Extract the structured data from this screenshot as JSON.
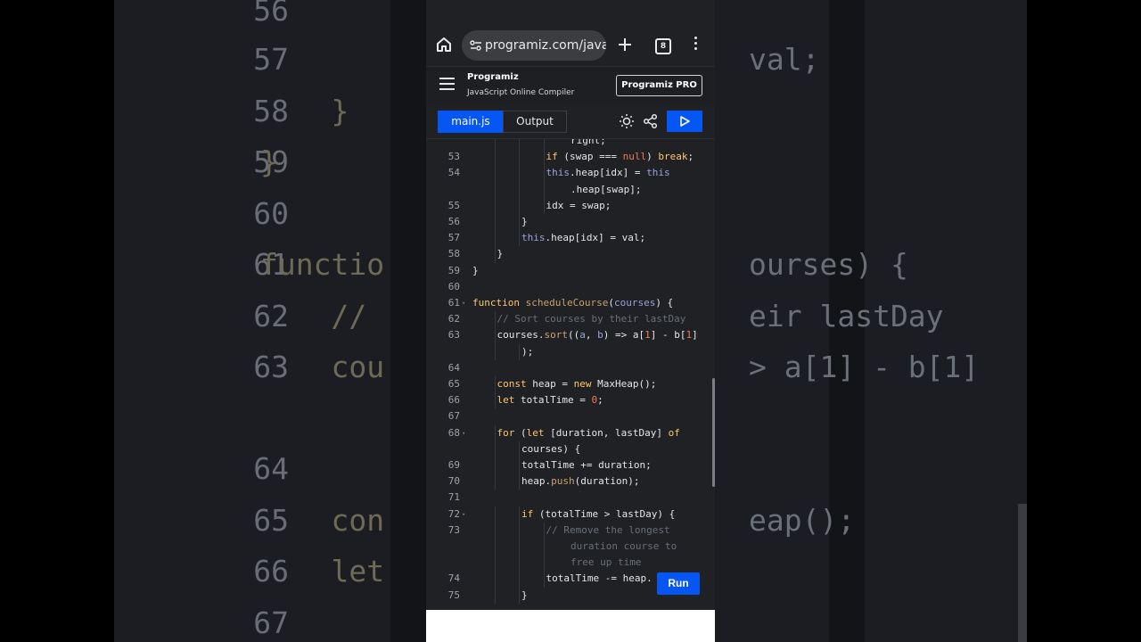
{
  "browser": {
    "url": "programiz.com/javasc",
    "tab_count": "8"
  },
  "site": {
    "logo": "Programiz",
    "subtitle": "JavaScript Online Compiler",
    "pro_button": "Programiz PRO"
  },
  "toolbar": {
    "tab_main": "main.js",
    "tab_output": "Output"
  },
  "run_button": "Run",
  "background": {
    "lines": [
      {
        "num": "56",
        "left": "",
        "right": ""
      },
      {
        "num": "57",
        "left": "",
        "right": "val;"
      },
      {
        "num": "58",
        "left": "    }",
        "right": ""
      },
      {
        "num": "59",
        "left": "}",
        "right": ""
      },
      {
        "num": "60",
        "left": "",
        "right": ""
      },
      {
        "num": "61",
        "left": "functio",
        "right": "ourses) {"
      },
      {
        "num": "62",
        "left": "    //",
        "right": "eir lastDay"
      },
      {
        "num": "63",
        "left": "    cou",
        "right": "> a[1] - b[1]"
      },
      {
        "num": "",
        "left": "",
        "right": ""
      },
      {
        "num": "64",
        "left": "",
        "right": ""
      },
      {
        "num": "65",
        "left": "    con",
        "right": "eap();"
      },
      {
        "num": "66",
        "left": "    let",
        "right": ""
      },
      {
        "num": "67",
        "left": "",
        "right": ""
      }
    ]
  },
  "code": {
    "lines": [
      {
        "n": "",
        "ind": 4,
        "html": "right;"
      },
      {
        "n": "53",
        "ind": 3,
        "html": "<span class='kw'>if</span> (swap === <span class='nu'>null</span>) <span class='kw'>break</span>;"
      },
      {
        "n": "54",
        "ind": 3,
        "html": "<span class='th'>this</span>.heap[idx] = <span class='th'>this</span>"
      },
      {
        "n": "",
        "ind": 4,
        "html": ".heap[swap];"
      },
      {
        "n": "55",
        "ind": 3,
        "html": "idx = swap;"
      },
      {
        "n": "56",
        "ind": 2,
        "html": "}"
      },
      {
        "n": "57",
        "ind": 2,
        "html": "<span class='th'>this</span>.heap[idx] = val;"
      },
      {
        "n": "58",
        "ind": 1,
        "html": "}"
      },
      {
        "n": "59",
        "ind": 0,
        "html": "}"
      },
      {
        "n": "60",
        "ind": 0,
        "html": ""
      },
      {
        "n": "61",
        "ind": 0,
        "fold": true,
        "html": "<span class='kw'>function</span> <span class='fn'>scheduleCourse</span>(<span class='th'>courses</span>) {"
      },
      {
        "n": "62",
        "ind": 1,
        "html": "<span class='cm'>// Sort courses by their lastDay</span>"
      },
      {
        "n": "63",
        "ind": 1,
        "html": "courses.<span class='fn'>sort</span>((<span class='th'>a</span>, <span class='th'>b</span>) => a[<span class='nu'>1</span>] - b[<span class='nu'>1</span>]"
      },
      {
        "n": "",
        "ind": 2,
        "html": ");"
      },
      {
        "n": "64",
        "ind": 0,
        "html": ""
      },
      {
        "n": "65",
        "ind": 1,
        "html": "<span class='kw'>const</span> heap = <span class='kw'>new</span> MaxHeap();"
      },
      {
        "n": "66",
        "ind": 1,
        "html": "<span class='kw'>let</span> totalTime = <span class='nu'>0</span>;"
      },
      {
        "n": "67",
        "ind": 0,
        "html": ""
      },
      {
        "n": "68",
        "ind": 1,
        "fold": true,
        "html": "<span class='kw'>for</span> (<span class='kw'>let</span> [duration, lastDay] <span class='kw'>of</span>"
      },
      {
        "n": "",
        "ind": 2,
        "html": "courses) {"
      },
      {
        "n": "69",
        "ind": 2,
        "html": "totalTime += duration;"
      },
      {
        "n": "70",
        "ind": 2,
        "html": "heap.<span class='fn'>push</span>(duration);"
      },
      {
        "n": "71",
        "ind": 0,
        "html": ""
      },
      {
        "n": "72",
        "ind": 2,
        "fold": true,
        "html": "<span class='kw'>if</span> (totalTime > lastDay) {"
      },
      {
        "n": "73",
        "ind": 3,
        "html": "<span class='cm'>// Remove the longest</span>"
      },
      {
        "n": "",
        "ind": 4,
        "html": "<span class='cm'>duration course to</span>"
      },
      {
        "n": "",
        "ind": 4,
        "html": "<span class='cm'>free up time</span>"
      },
      {
        "n": "74",
        "ind": 3,
        "html": "totalTime -= heap."
      },
      {
        "n": "75",
        "ind": 2,
        "html": "}"
      }
    ]
  }
}
